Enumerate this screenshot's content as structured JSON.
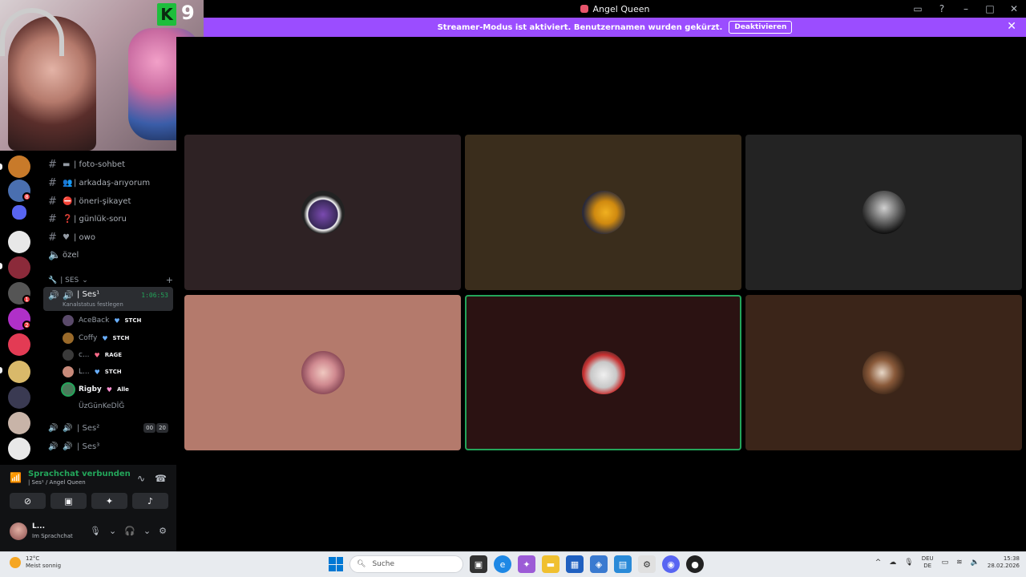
{
  "window": {
    "title": "Angel Queen"
  },
  "banner": {
    "text": "Streamer-Modus ist aktiviert. Benutzernamen wurden gekürzt.",
    "button": "Deaktivieren"
  },
  "webcam": {
    "badge_letter": "K",
    "badge_number": "9"
  },
  "channels": {
    "text": [
      {
        "emoji": "▬",
        "name": "| foto-sohbet"
      },
      {
        "emoji": "👥",
        "name": "| arkadaş-arıyorum"
      },
      {
        "emoji": "⛔",
        "name": "| öneri-şikayet"
      },
      {
        "emoji": "❓",
        "name": "| günlük-soru"
      },
      {
        "emoji": "♥",
        "name": "| owo"
      }
    ],
    "ozel": "özel",
    "category": "| SES",
    "active_voice": {
      "name": "| Ses¹",
      "timer": "1:06:53",
      "status": "Kanalstatus festlegen"
    },
    "members": [
      {
        "name": "AceBack",
        "tag": "STCH",
        "heart": "#6ab0ff"
      },
      {
        "name": "Coffy",
        "tag": "STCH",
        "heart": "#6ab0ff"
      },
      {
        "name": "c...",
        "tag": "RAGE",
        "heart": "#ff6b8a"
      },
      {
        "name": "L...",
        "tag": "STCH",
        "heart": "#6ab0ff"
      },
      {
        "name": "Rigby",
        "tag": "Alle",
        "heart": "#ff8fd0"
      },
      {
        "name": "ÜzGünKeDİĞ",
        "tag": "",
        "heart": ""
      }
    ],
    "voice2": {
      "name": "| Ses²",
      "count_a": "00",
      "count_b": "20"
    },
    "voice3": {
      "name": "| Ses³"
    }
  },
  "voice_panel": {
    "connected": "Sprachchat verbunden",
    "location": "| Ses¹ / Angel Queen",
    "user_name": "L...",
    "user_status": "Im Sprachchat"
  },
  "tiles": [
    {
      "bg": "#2e2224"
    },
    {
      "bg": "#3a2d1c"
    },
    {
      "bg": "#232323"
    },
    {
      "bg": "#b47a6c"
    },
    {
      "bg": "#2b1212",
      "speaking": true
    },
    {
      "bg": "#3b2519"
    }
  ],
  "taskbar": {
    "temp": "12°C",
    "weather": "Meist sonnig",
    "search": "Suche",
    "lang_top": "DEU",
    "lang_bottom": "DE",
    "time": "15:38",
    "date": "28.02.2026"
  }
}
